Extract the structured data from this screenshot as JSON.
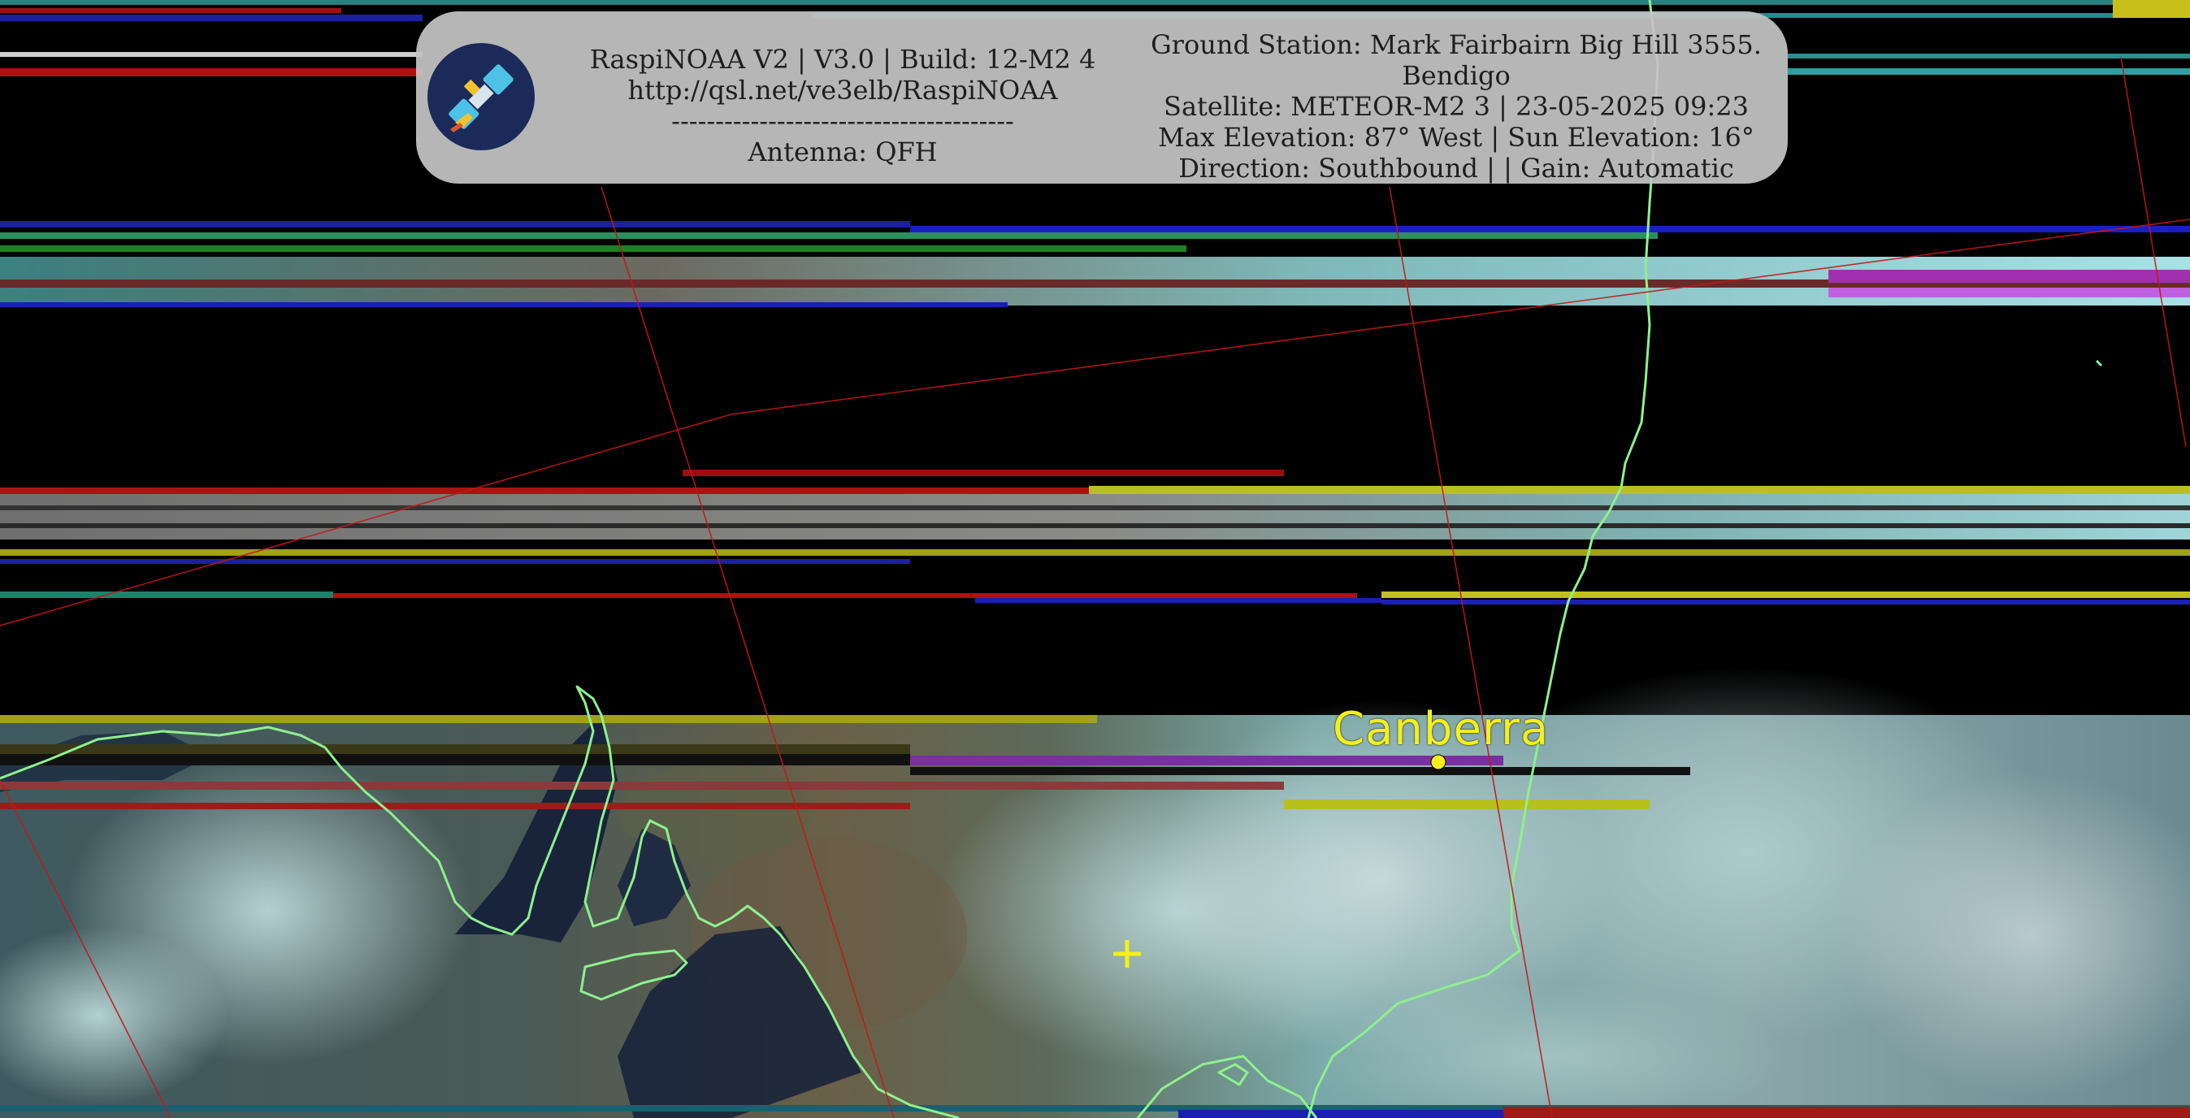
{
  "header": {
    "left_lines": [
      "RaspiNOAA V2 | V3.0 | Build: 12-M2 4",
      "http://qsl.net/ve3elb/RaspiNOAA",
      "---------------------------------------",
      "Antenna: QFH"
    ],
    "right_lines": [
      "Ground Station: Mark Fairbairn Big Hill 3555.",
      "Bendigo",
      "Satellite: METEOR-M2 3 | 23-05-2025 09:23",
      "Max Elevation: 87° West | Sun Elevation: 16°",
      "Direction: Southbound | | Gain: Automatic"
    ]
  },
  "map": {
    "city_label": "Canberra",
    "coastline_color": "#8ef08e",
    "graticule_color": "#c01818",
    "marker_color": "#f5ef1a",
    "icons": {
      "logo": "satellite-icon",
      "city_marker": "city-dot-icon",
      "station_marker": "crosshair-icon"
    }
  }
}
